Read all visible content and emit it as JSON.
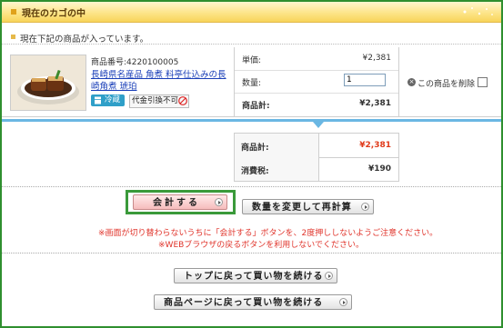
{
  "header": {
    "title": "現在のカゴの中"
  },
  "notice": "現在下記の商品が入っています。",
  "item": {
    "image_icon": "food-photo",
    "product_number": "商品番号:4220100005",
    "product_name": "長崎県名産品 角煮 料亭仕込みの長崎角煮 琥珀",
    "badge_cold": "冷蔵",
    "badge_cod": "代金引換不可",
    "unit_price_label": "単価:",
    "unit_price": "¥2,381",
    "quantity_label": "数量:",
    "quantity_value": "1",
    "subtotal_label": "商品計:",
    "subtotal": "¥2,381",
    "delete_label": "この商品を削除"
  },
  "summary": {
    "total_label": "商品計:",
    "total_value": "¥2,381",
    "tax_label": "消費税:",
    "tax_value": "¥190"
  },
  "actions": {
    "checkout_label": "会計する",
    "recalc_label": "数量を変更して再計算"
  },
  "warnings": {
    "line1": "※画面が切り替わらないうちに「会計する」ボタンを、2度押ししないようご注意ください。",
    "line2": "※WEBブラウザの戻るボタンを利用しないでください。"
  },
  "navigation": {
    "back_to_top_label": "トップに戻って買い物を続ける",
    "back_to_product_label": "商品ページに戻って買い物を続ける"
  },
  "colors": {
    "frame_border": "#2f8f2f",
    "header_bg": "#fde58a",
    "accent_blue": "#6ab7e3",
    "price_red": "#e03a1a",
    "warning_red": "#e0332a",
    "link_blue": "#1a3fb8"
  }
}
